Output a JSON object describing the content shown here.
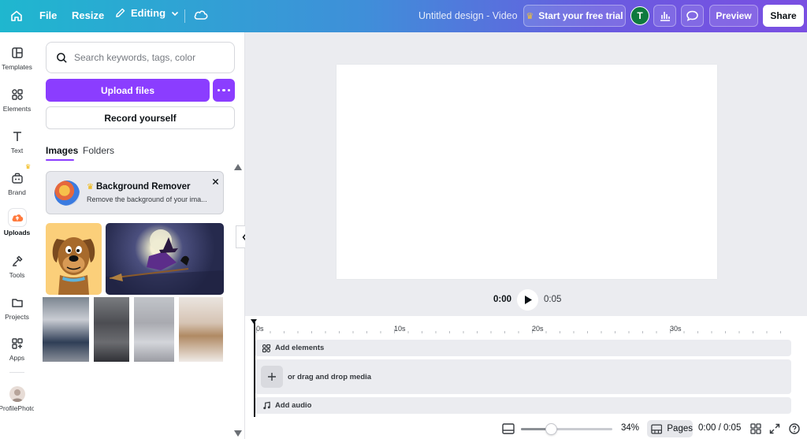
{
  "topbar": {
    "file_label": "File",
    "resize_label": "Resize",
    "editing_label": "Editing",
    "design_title": "Untitled design - Video",
    "trial_label": "Start your free trial",
    "avatar_initial": "T",
    "preview_label": "Preview",
    "share_label": "Share"
  },
  "rail": {
    "items": [
      {
        "label": "Templates",
        "icon": "templates-icon"
      },
      {
        "label": "Elements",
        "icon": "elements-icon"
      },
      {
        "label": "Text",
        "icon": "text-icon"
      },
      {
        "label": "Brand",
        "icon": "brand-icon"
      },
      {
        "label": "Uploads",
        "icon": "uploads-icon"
      },
      {
        "label": "Tools",
        "icon": "tools-icon"
      },
      {
        "label": "Projects",
        "icon": "projects-icon"
      },
      {
        "label": "Apps",
        "icon": "apps-icon"
      },
      {
        "label": "ProfilePhoto",
        "icon": "profile-photo-icon"
      }
    ]
  },
  "panel": {
    "search_placeholder": "Search keywords, tags, color",
    "upload_label": "Upload files",
    "record_label": "Record yourself",
    "tabs": [
      {
        "label": "Images"
      },
      {
        "label": "Folders"
      }
    ],
    "promo": {
      "title": "Background Remover",
      "subtitle": "Remove the background of your ima..."
    }
  },
  "canvas": {
    "time_current": "0:00",
    "time_end": "0:05"
  },
  "timeline": {
    "ticks": [
      "0s",
      "10s",
      "20s",
      "30s"
    ],
    "add_elements": "Add elements",
    "drag_media": "or drag and drop media",
    "add_audio": "Add audio"
  },
  "footer": {
    "zoom_level": "34%",
    "zoom_fraction": 0.34,
    "pages_label": "Pages",
    "time_display": "0:00 / 0:05"
  },
  "colors": {
    "accent": "#8b3dff",
    "topbar_start": "#1fb7cf",
    "topbar_end": "#7a4fe2"
  }
}
